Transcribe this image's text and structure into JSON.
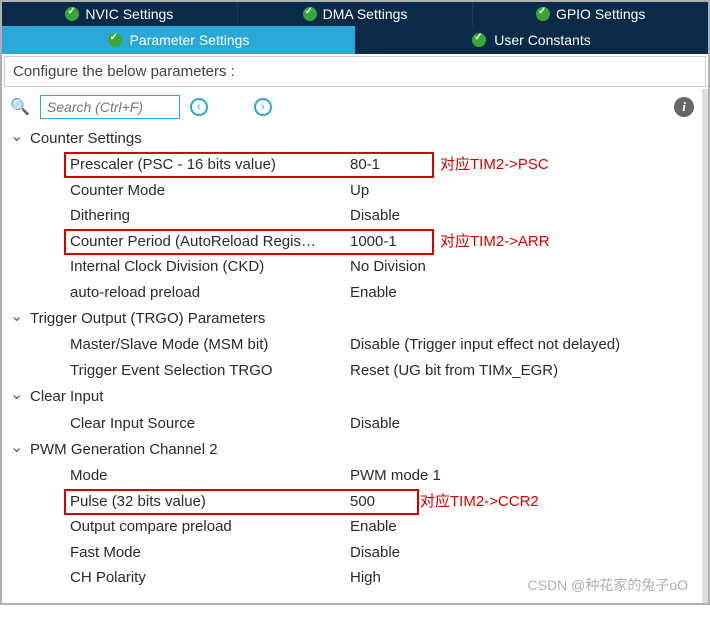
{
  "topTabs": {
    "nvic": "NVIC Settings",
    "dma": "DMA Settings",
    "gpio": "GPIO Settings"
  },
  "subTabs": {
    "param": "Parameter Settings",
    "user": "User Constants"
  },
  "instruction": "Configure the below parameters :",
  "search": {
    "placeholder": "Search (Ctrl+F)"
  },
  "sections": {
    "counter": {
      "title": "Counter Settings",
      "prescaler": {
        "label": "Prescaler (PSC - 16 bits value)",
        "value": "80-1",
        "annotation": "对应TIM2->PSC"
      },
      "mode": {
        "label": "Counter Mode",
        "value": "Up"
      },
      "dithering": {
        "label": "Dithering",
        "value": "Disable"
      },
      "period": {
        "label": "Counter Period (AutoReload Regis…",
        "value": "1000-1",
        "annotation": "对应TIM2->ARR"
      },
      "ckd": {
        "label": "Internal Clock Division (CKD)",
        "value": "No Division"
      },
      "preload": {
        "label": "auto-reload preload",
        "value": "Enable"
      }
    },
    "trgo": {
      "title": "Trigger Output (TRGO) Parameters",
      "msm": {
        "label": "Master/Slave Mode (MSM bit)",
        "value": "Disable (Trigger input effect not delayed)"
      },
      "event": {
        "label": "Trigger Event Selection TRGO",
        "value": "Reset (UG bit from TIMx_EGR)"
      }
    },
    "clear": {
      "title": "Clear Input",
      "source": {
        "label": "Clear Input Source",
        "value": "Disable"
      }
    },
    "pwm": {
      "title": "PWM Generation Channel 2",
      "mode": {
        "label": "Mode",
        "value": "PWM mode 1"
      },
      "pulse": {
        "label": "Pulse (32 bits value)",
        "value": "500",
        "annotation": "对应TIM2->CCR2"
      },
      "ocp": {
        "label": "Output compare preload",
        "value": "Enable"
      },
      "fast": {
        "label": "Fast Mode",
        "value": "Disable"
      },
      "polarity": {
        "label": "CH Polarity",
        "value": "High"
      }
    }
  },
  "watermark": "CSDN @种花家的兔子oO"
}
